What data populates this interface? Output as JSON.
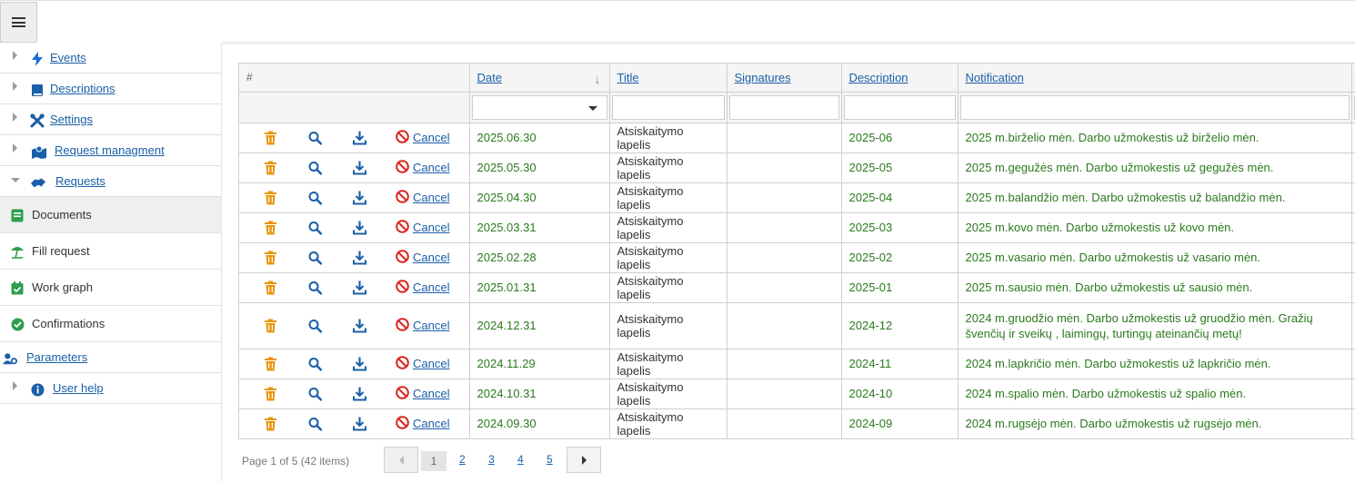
{
  "sidebar": {
    "items": [
      {
        "label": "Events",
        "icon": "bolt-icon"
      },
      {
        "label": "Descriptions",
        "icon": "book-icon"
      },
      {
        "label": "Settings",
        "icon": "tools-icon"
      },
      {
        "label": "Request managment",
        "icon": "map-icon"
      },
      {
        "label": "Requests",
        "icon": "handshake-icon"
      }
    ],
    "subitems": [
      {
        "label": "Documents",
        "icon": "document-icon"
      },
      {
        "label": "Fill request",
        "icon": "umbrella-beach-icon"
      },
      {
        "label": "Work graph",
        "icon": "calendar-check-icon"
      },
      {
        "label": "Confirmations",
        "icon": "check-circle-icon"
      }
    ],
    "parameters": {
      "label": "Parameters",
      "icon": "users-gear-icon"
    },
    "help": {
      "label": "User help",
      "icon": "info-icon"
    }
  },
  "table": {
    "headers": {
      "hash": "#",
      "date": "Date",
      "title": "Title",
      "signatures": "Signatures",
      "description": "Description",
      "notification": "Notification"
    },
    "cancel_label": "Cancel",
    "rows": [
      {
        "date": "2025.06.30",
        "title": "Atsiskaitymo lapelis",
        "signatures": "",
        "description": "2025-06",
        "notification": "2025 m.birželio mėn. Darbo užmokestis už birželio mėn."
      },
      {
        "date": "2025.05.30",
        "title": "Atsiskaitymo lapelis",
        "signatures": "",
        "description": "2025-05",
        "notification": "2025 m.gegužės mėn. Darbo užmokestis už gegužės mėn."
      },
      {
        "date": "2025.04.30",
        "title": "Atsiskaitymo lapelis",
        "signatures": "",
        "description": "2025-04",
        "notification": "2025 m.balandžio mėn. Darbo užmokestis už balandžio mėn."
      },
      {
        "date": "2025.03.31",
        "title": "Atsiskaitymo lapelis",
        "signatures": "",
        "description": "2025-03",
        "notification": "2025 m.kovo mėn. Darbo užmokestis už kovo mėn."
      },
      {
        "date": "2025.02.28",
        "title": "Atsiskaitymo lapelis",
        "signatures": "",
        "description": "2025-02",
        "notification": "2025 m.vasario mėn. Darbo užmokestis už vasario mėn."
      },
      {
        "date": "2025.01.31",
        "title": "Atsiskaitymo lapelis",
        "signatures": "",
        "description": "2025-01",
        "notification": "2025 m.sausio mėn. Darbo užmokestis už sausio mėn."
      },
      {
        "date": "2024.12.31",
        "title": "Atsiskaitymo lapelis",
        "signatures": "",
        "description": "2024-12",
        "notification": "2024 m.gruodžio mėn. Darbo užmokestis už gruodžio mėn. Gražių švenčių ir sveikų , laimingų, turtingų ateinančių metų!"
      },
      {
        "date": "2024.11.29",
        "title": "Atsiskaitymo lapelis",
        "signatures": "",
        "description": "2024-11",
        "notification": "2024 m.lapkričio mėn. Darbo užmokestis už lapkričio mėn."
      },
      {
        "date": "2024.10.31",
        "title": "Atsiskaitymo lapelis",
        "signatures": "",
        "description": "2024-10",
        "notification": "2024 m.spalio mėn. Darbo užmokestis už spalio mėn."
      },
      {
        "date": "2024.09.30",
        "title": "Atsiskaitymo lapelis",
        "signatures": "",
        "description": "2024-09",
        "notification": "2024 m.rugsėjo mėn. Darbo užmokestis už rugsėjo mėn."
      }
    ]
  },
  "pager": {
    "info": "Page 1 of 5 (42 items)",
    "current": "1",
    "pages": [
      "2",
      "3",
      "4",
      "5"
    ]
  },
  "colors": {
    "link": "#1a5fa8",
    "green_text": "#2b7a1e",
    "trash": "#e8960c",
    "cancel_red": "#d9261c"
  }
}
